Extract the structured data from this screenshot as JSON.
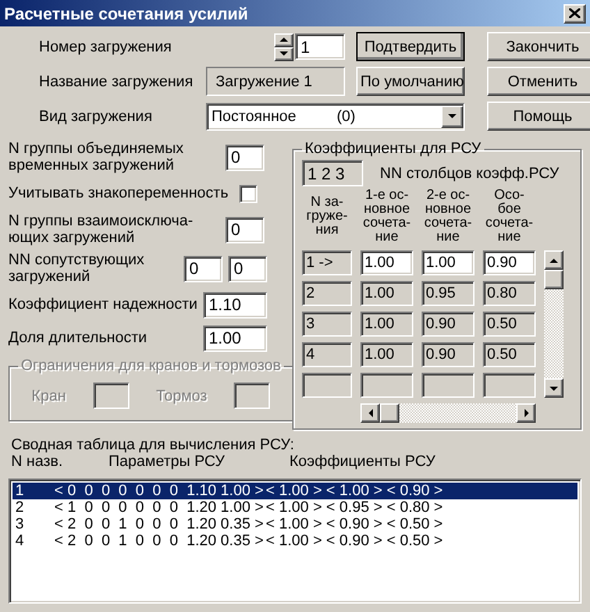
{
  "window": {
    "title": "Расчетные сочетания усилий"
  },
  "load_number": {
    "label": "Номер загружения",
    "value": "1"
  },
  "load_name": {
    "label": "Название загружения",
    "value": "Загружение 1"
  },
  "load_type": {
    "label": "Вид загружения",
    "value": "Постоянное",
    "code": "(0)"
  },
  "action_buttons": [
    {
      "label": "Подтвердить",
      "default": true
    },
    {
      "label": "По умолчанию",
      "default": false
    }
  ],
  "side_buttons": [
    {
      "label": "Закончить",
      "default": false
    },
    {
      "label": "Отменить",
      "default": false
    },
    {
      "label": "Помощь",
      "default": false
    }
  ],
  "fields": [
    {
      "kind": "count_field",
      "label": "N группы объединяемых\nвременных загружений",
      "values": [
        "0"
      ]
    },
    {
      "kind": "checkbox",
      "label": "Учитывать знакопеременность",
      "checked": false
    },
    {
      "kind": "count_field",
      "label": "N группы взаимоисключа-\nющих загружений",
      "values": [
        "0"
      ]
    },
    {
      "kind": "count_field",
      "label": "NN сопутствующих\nзагружений",
      "values": [
        "0",
        "0"
      ]
    },
    {
      "kind": "factor_field",
      "label": "Коэффициент надежности",
      "values": [
        "1.10"
      ]
    },
    {
      "kind": "factor_field",
      "label": "Доля длительности",
      "values": [
        "1.00"
      ]
    }
  ],
  "limits": {
    "title": "Ограничения для кранов и тормозов",
    "disabled": true,
    "fields": [
      "Кран",
      "Тормоз"
    ]
  },
  "coefficients": {
    "title": "Коэффициенты для РСУ",
    "columns_value": "1 2 3",
    "columns_label": "NN столбцов коэфф.РСУ",
    "headers": [
      "N за-\nгруже-\nния",
      "1-е ос-\nновное\nсочета-\nние",
      "2-е ос-\nновное\nсочета-\nние",
      "Осо-\nбое\nсочета-\nние"
    ],
    "rows": [
      {
        "kind": "entry",
        "load": "1 ->",
        "values": [
          "1.00",
          "1.00",
          "0.90"
        ],
        "selected": true
      },
      {
        "kind": "entry",
        "load": "2",
        "values": [
          "1.00",
          "0.95",
          "0.80"
        ],
        "selected": false
      },
      {
        "kind": "entry",
        "load": "3",
        "values": [
          "1.00",
          "0.90",
          "0.50"
        ],
        "selected": false
      },
      {
        "kind": "entry",
        "load": "4",
        "values": [
          "1.00",
          "0.90",
          "0.50"
        ],
        "selected": false
      },
      {
        "kind": "blank"
      }
    ]
  },
  "summary": {
    "title": "Сводная таблица для вычисления РСУ:",
    "headers": [
      "N назв.",
      "Параметры РСУ",
      "Коэффициенты РСУ"
    ],
    "rows": [
      {
        "number": "1",
        "params": "< 0  0  0  0  0  0  0  1.10 1.00 >",
        "coefs": "< 1.00 > < 1.00 > < 0.90 >",
        "selected": true
      },
      {
        "number": "2",
        "params": "< 1  0  0  0  0  0  0  1.20 1.00 >",
        "coefs": "< 1.00 > < 0.95 > < 0.80 >",
        "selected": false
      },
      {
        "number": "3",
        "params": "< 2  0  0  1  0  0  0  1.20 0.35 >",
        "coefs": "< 1.00 > < 0.90 > < 0.50 >",
        "selected": false
      },
      {
        "number": "4",
        "params": "< 2  0  0  1  0  0  0  1.20 0.35 >",
        "coefs": "< 1.00 > < 0.90 > < 0.50 >",
        "selected": false
      }
    ]
  }
}
